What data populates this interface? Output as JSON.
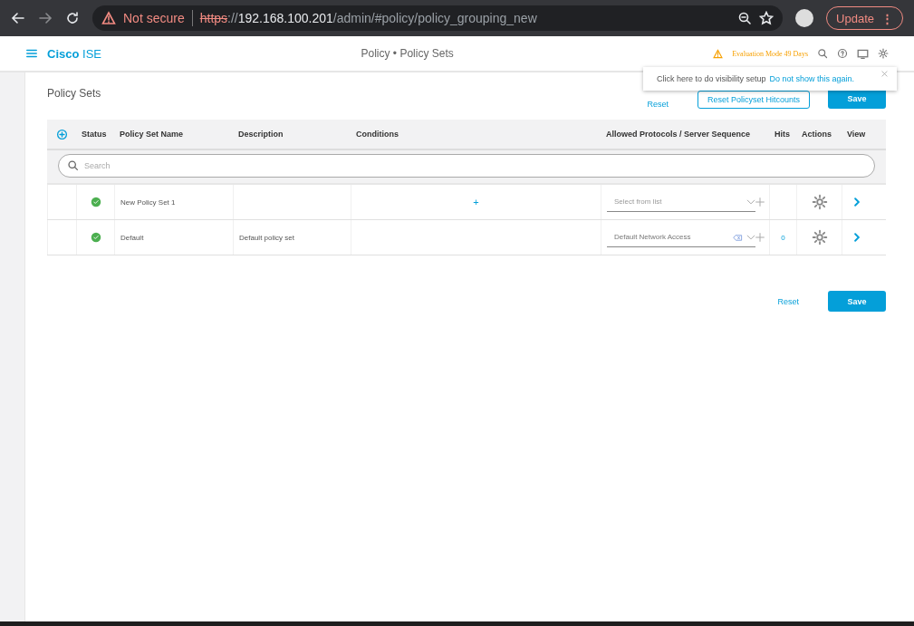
{
  "browser": {
    "security": "Not secure",
    "url_scheme": "https",
    "url_separator": "://",
    "url_host": "192.168.100.201",
    "url_path": "/admin/#policy/policy_grouping_new",
    "update": "Update",
    "menu": "⋮"
  },
  "header": {
    "brand": "Cisco",
    "product": "ISE",
    "title": "Policy • Policy Sets",
    "evaluation": "Evaluation Mode 49 Days"
  },
  "popover": {
    "text": "Click here to do visibility setup",
    "link": "Do not show this again."
  },
  "page": {
    "title": "Policy Sets",
    "top_actions": {
      "reset": "Reset",
      "reset_hitcounts": "Reset Policyset Hitcounts",
      "save": "Save"
    }
  },
  "table": {
    "columns": [
      "Status",
      "Policy Set Name",
      "Description",
      "Conditions",
      "Allowed Protocols / Server Sequence",
      "Hits",
      "Actions",
      "View"
    ],
    "search": {
      "placeholder": "Search"
    },
    "rows": [
      {
        "name": "New Policy Set 1",
        "description": "",
        "conditions": "+",
        "protocol": {
          "placeholder": "Select from list"
        },
        "hits": ""
      },
      {
        "name": "Default",
        "description": "Default policy set",
        "conditions": "",
        "protocol": {
          "value": "Default Network Access"
        },
        "hits": "0"
      }
    ]
  },
  "bottom_actions": {
    "reset": "Reset",
    "save": "Save"
  }
}
